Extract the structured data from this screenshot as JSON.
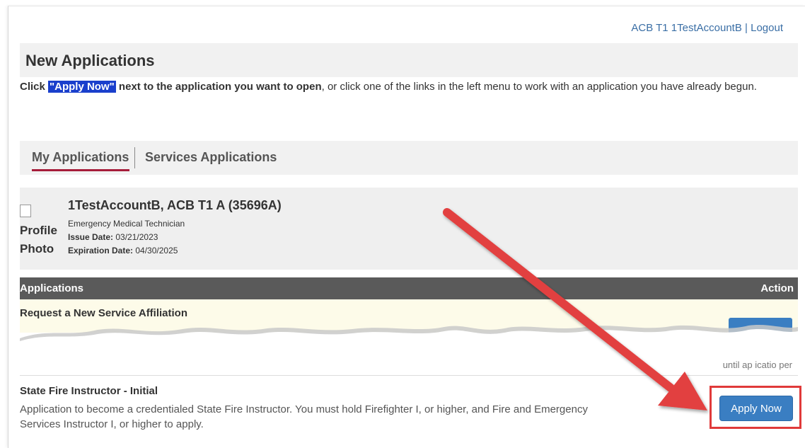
{
  "header": {
    "account_label": "ACB T1 1TestAccountB",
    "separator": "|",
    "logout_label": "Logout"
  },
  "page": {
    "title": "New Applications",
    "instructions": {
      "prefix": "Click ",
      "highlight": "\"Apply Now\"",
      "bold_rest": " next to the application you want to open",
      "suffix": ", or click one of the links in the left menu to work with an application you have already begun."
    }
  },
  "tabs": [
    {
      "label": "My Applications",
      "active": true
    },
    {
      "label": "Services Applications",
      "active": false
    }
  ],
  "profile": {
    "photo_alt": "Profile Photo",
    "name": "1TestAccountB, ACB T1 A (35696A)",
    "certification": "Emergency Medical Technician",
    "issue_label": "Issue Date:",
    "issue_date": "03/21/2023",
    "expiration_label": "Expiration Date:",
    "expiration_date": "04/30/2025"
  },
  "applications_table": {
    "header_left": "Applications",
    "header_right": "Action",
    "rows": [
      {
        "title": "Request a New Service Affiliation",
        "description": "",
        "note": ""
      },
      {
        "title": "",
        "description": "",
        "note": "until ap",
        "note_partial": "icatio  per"
      },
      {
        "title": "State Fire Instructor - Initial",
        "description": "Application to become a credentialed State Fire Instructor. You must hold Firefighter I, or higher, and Fire and Emergency Services Instructor I, or higher to apply.",
        "action_label": "Apply Now"
      }
    ]
  },
  "colors": {
    "accent_blue": "#3a7ec2",
    "tab_underline": "#a61d3a",
    "header_bg": "#5a5a5a",
    "annotation_red": "#e03a3a",
    "highlight_bg": "#1a3fcc"
  }
}
